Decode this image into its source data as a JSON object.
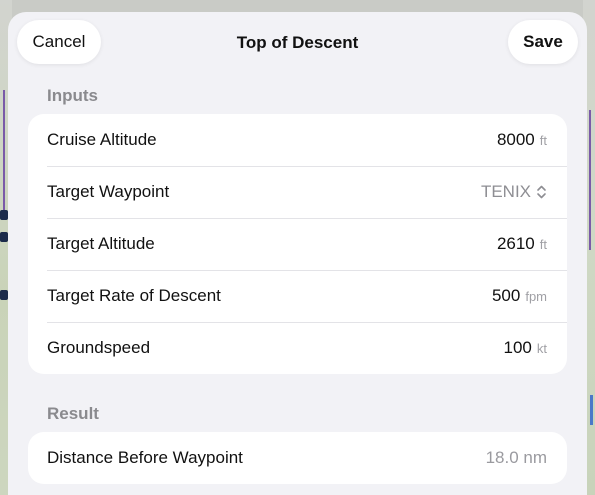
{
  "nav": {
    "cancel_label": "Cancel",
    "title": "Top of Descent",
    "save_label": "Save"
  },
  "inputs": {
    "header": "Inputs",
    "cruise_altitude": {
      "label": "Cruise Altitude",
      "value": "8000",
      "unit": "ft"
    },
    "target_waypoint": {
      "label": "Target Waypoint",
      "value": "TENIX",
      "icon": "chevron-up-down-icon"
    },
    "target_altitude": {
      "label": "Target Altitude",
      "value": "2610",
      "unit": "ft"
    },
    "target_rate": {
      "label": "Target Rate of Descent",
      "value": "500",
      "unit": "fpm"
    },
    "groundspeed": {
      "label": "Groundspeed",
      "value": "100",
      "unit": "kt"
    }
  },
  "result": {
    "header": "Result",
    "distance": {
      "label": "Distance Before Waypoint",
      "value": "18.0 nm"
    }
  },
  "colors": {
    "sheet_bg": "#f2f2f6",
    "card_bg": "#ffffff",
    "secondary_text": "#8a8a8e",
    "route_line": "#7a5aa8"
  }
}
